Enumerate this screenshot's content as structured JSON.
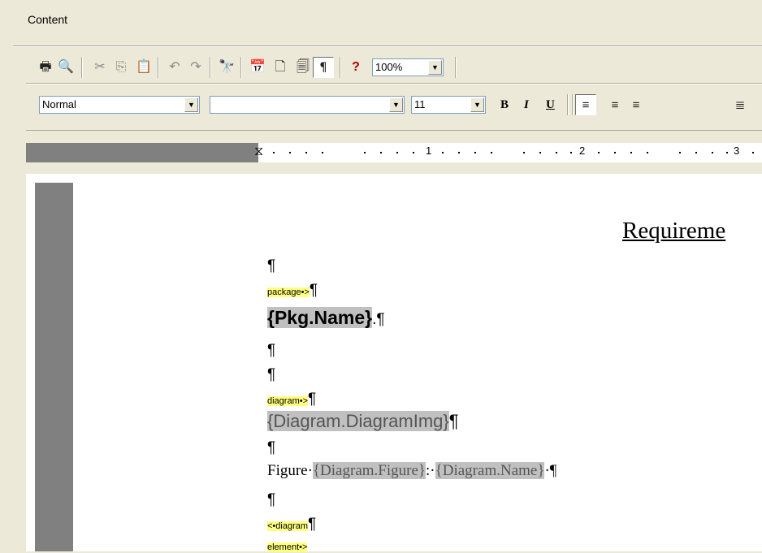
{
  "window": {
    "title": "Content"
  },
  "toolbar1": {
    "icons": [
      "print-icon",
      "print-preview-icon",
      "cut-icon",
      "copy-icon",
      "paste-icon",
      "undo-icon",
      "redo-icon",
      "find-icon",
      "insert-date-icon",
      "page-icon",
      "page-number-icon",
      "paragraph-mark-icon",
      "help-icon"
    ],
    "zoom": "100%"
  },
  "toolbar2": {
    "style": "Normal",
    "font": "",
    "size": "11",
    "bold": "B",
    "italic": "I",
    "underline": "U"
  },
  "ruler": {
    "marks": [
      "1",
      "2",
      "3"
    ]
  },
  "document": {
    "heading": "Requireme",
    "pilcrow": "¶",
    "tag_package": "package•>",
    "pkg_name": "{Pkg.Name}",
    "pkg_name_suffix": ".¶",
    "tag_diagram": "diagram•>",
    "diagram_img": "{Diagram.DiagramImg}",
    "figure_label": "Figure·",
    "diagram_figure": "{Diagram.Figure}",
    "figure_sep": ":·",
    "diagram_name": "{Diagram.Name}",
    "figure_end": "·¶",
    "tag_diagram_element": "<•diagram",
    "tag_element_partial": "element•>"
  }
}
